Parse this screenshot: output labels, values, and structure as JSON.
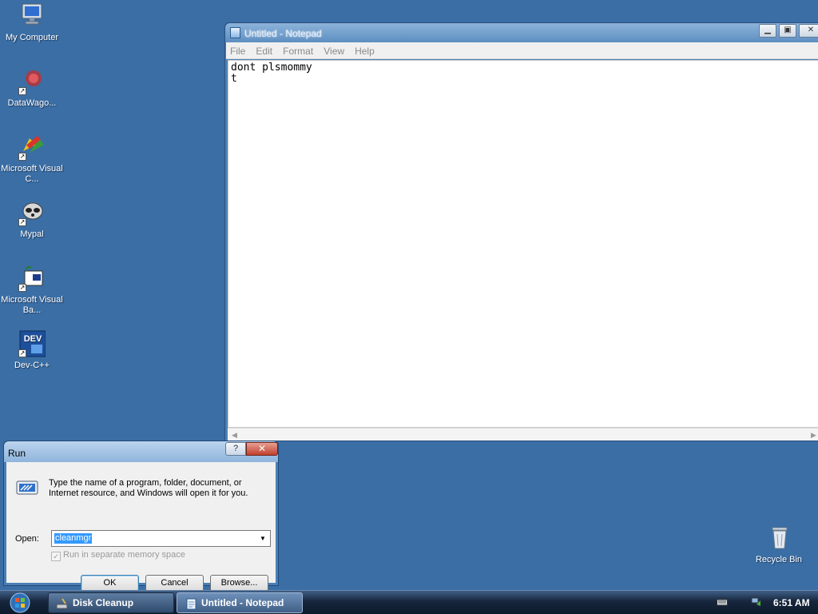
{
  "desktop": {
    "icons": [
      {
        "label": "My Computer"
      },
      {
        "label": "DataWago..."
      },
      {
        "label": "Microsoft Visual C..."
      },
      {
        "label": "Mypal"
      },
      {
        "label": "Microsoft Visual Ba..."
      },
      {
        "label": "Dev-C++"
      },
      {
        "label": "Recycle Bin"
      }
    ]
  },
  "notepad": {
    "title": "Untitled - Notepad",
    "menu": [
      "File",
      "Edit",
      "Format",
      "View",
      "Help"
    ],
    "content": "dont plsmommy\nt"
  },
  "run_dialog": {
    "title": "Run",
    "help_label": "?",
    "close_label": "✕",
    "description": "Type the name of a program, folder, document, or Internet resource, and Windows will open it for you.",
    "open_label": "Open:",
    "open_value": "cleanmgr",
    "separate_memory_label": "Run in separate memory space",
    "ok_label": "OK",
    "cancel_label": "Cancel",
    "browse_label": "Browse..."
  },
  "taskbar": {
    "items": [
      {
        "label": "Disk Cleanup"
      },
      {
        "label": "Untitled - Notepad"
      }
    ],
    "clock": "6:51 AM"
  }
}
